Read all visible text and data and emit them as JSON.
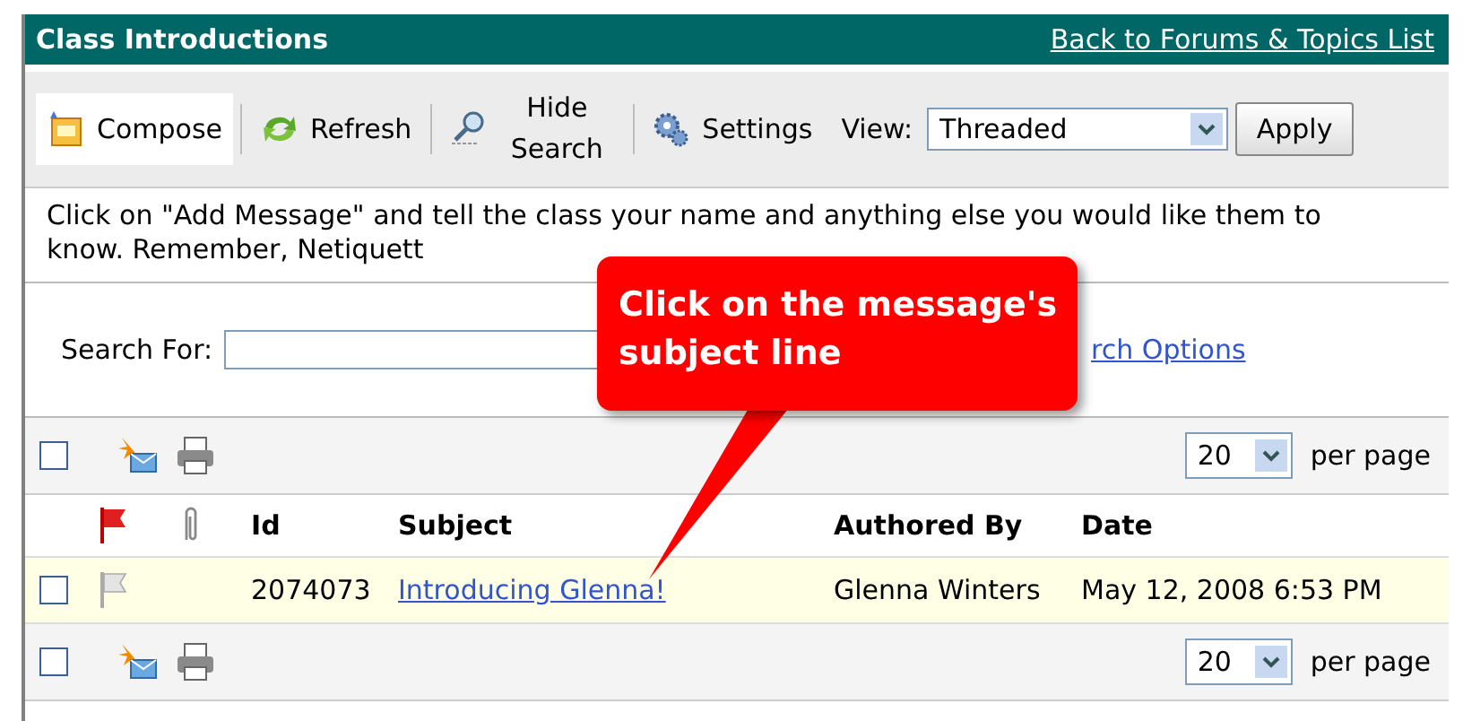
{
  "header": {
    "title": "Class Introductions",
    "back_link": "Back to Forums & Topics List"
  },
  "toolbar": {
    "buttons": [
      {
        "kind": "compose",
        "label": "Compose",
        "selected": true
      },
      {
        "kind": "refresh",
        "label": "Refresh",
        "selected": false
      },
      {
        "kind": "search",
        "label": "Hide Search",
        "selected": false
      },
      {
        "kind": "settings",
        "label": "Settings",
        "selected": false
      }
    ],
    "view_label": "View:",
    "view_value": "Threaded",
    "apply": "Apply"
  },
  "instructions": "Click on \"Add Message\" and tell the class your name and anything else you would like them to know. Remember, Netiquett",
  "search": {
    "label": "Search For:",
    "options_link": "rch Options"
  },
  "list_toolbars": [
    {
      "checked": false,
      "per_page": "20",
      "per_page_label": "per page"
    },
    {
      "checked": false,
      "per_page": "20",
      "per_page_label": "per page"
    }
  ],
  "table": {
    "columns": [
      "Id",
      "Subject",
      "Authored By",
      "Date"
    ],
    "rows": [
      {
        "checked": false,
        "flagged": false,
        "id": "2074073",
        "subject": "Introducing Glenna!",
        "author": "Glenna Winters",
        "date": "May 12, 2008 6:53 PM"
      }
    ]
  },
  "callout": {
    "text": "Click on the message's subject line"
  }
}
